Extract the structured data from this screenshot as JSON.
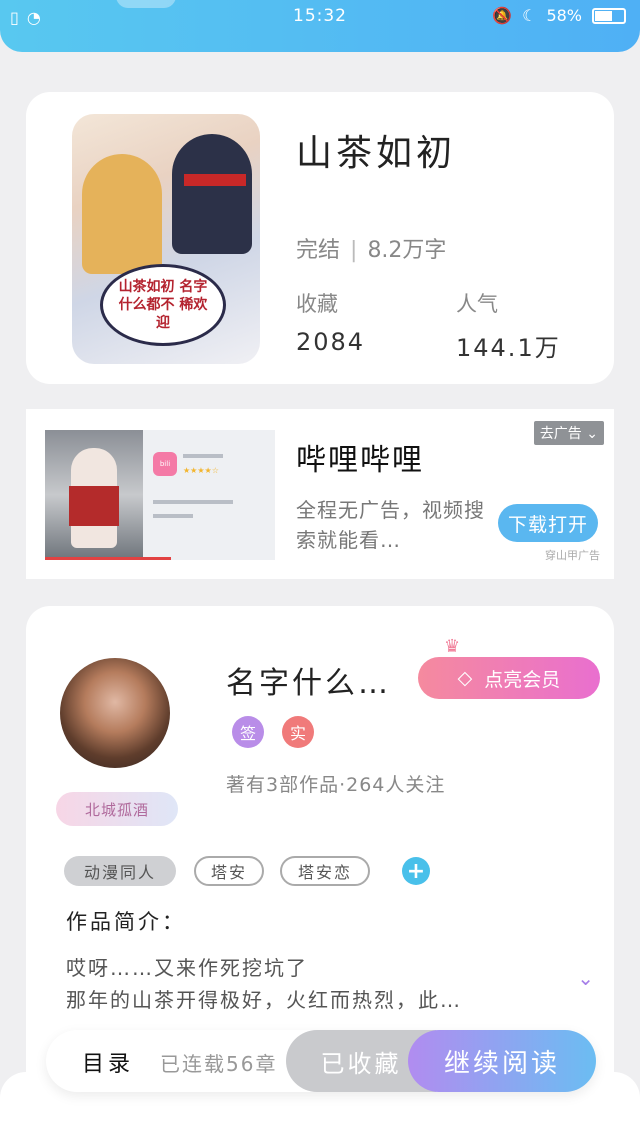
{
  "status_bar": {
    "time": "15:32",
    "battery": "58%"
  },
  "book": {
    "title": "山茶如初",
    "status": "完结",
    "word_count": "8.2万字",
    "favorites_label": "收藏",
    "favorites_value": "2084",
    "popularity_label": "人气",
    "popularity_value": "144.1万",
    "cover_text": "山茶如初 名字什么都不 稀欢迎"
  },
  "ad": {
    "title": "哔哩哔哩",
    "description": "全程无广告，视频搜索就能看…",
    "close_label": "去广告",
    "download_label": "下载打开",
    "source": "穿山甲广告",
    "app_name": "哔哩哔哩",
    "rating": "3.3"
  },
  "author": {
    "name": "名字什么…",
    "vip_label": "点亮会员",
    "badge_sign": "签",
    "badge_real": "实",
    "meta": "著有3部作品·264人关注",
    "avatar_badge": "北城孤酒",
    "tags": [
      "动漫同人",
      "塔安",
      "塔安恋"
    ],
    "intro_heading": "作品简介：",
    "intro_line1": "哎呀……又来作死挖坑了",
    "intro_line2": "那年的山茶开得极好，火红而热烈，此…"
  },
  "bottom_bar": {
    "catalog": "目录",
    "chapters": "已连载56章",
    "collected": "已收藏",
    "continue": "继续阅读"
  },
  "colors": {
    "status_bar": "#4fb0f5",
    "vip_gradient_start": "#f58a9e",
    "continue_gradient_start": "#b18cf0",
    "continue_gradient_end": "#6bbdf2",
    "download": "#5ab7f0"
  }
}
